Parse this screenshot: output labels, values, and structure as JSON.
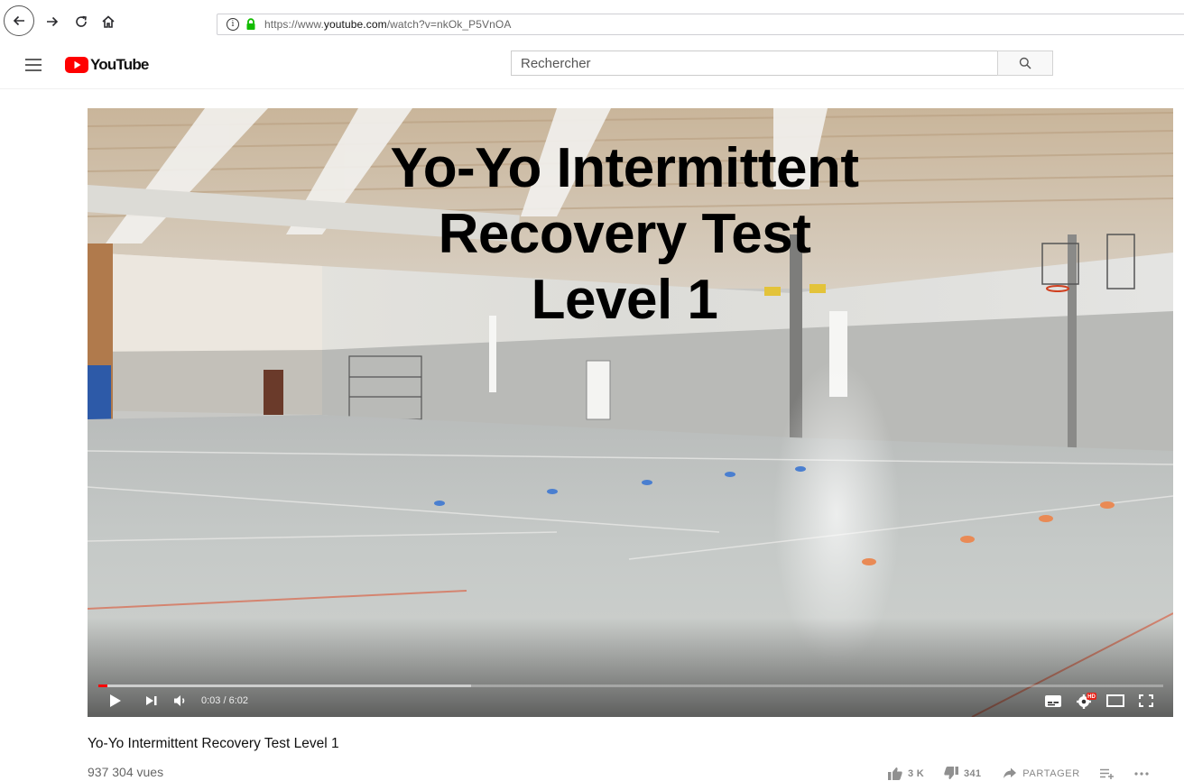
{
  "browser": {
    "url_prefix": "https://www.",
    "url_domain": "youtube.com",
    "url_path": "/watch?v=nkOk_P5VnOA"
  },
  "masthead": {
    "logo_text": "YouTube",
    "search_placeholder": "Rechercher"
  },
  "player": {
    "overlay_title_lines": [
      "Yo-Yo Intermittent",
      "Recovery Test",
      "Level 1"
    ],
    "time_current": "0:03",
    "time_total": "6:02",
    "time_display": "0:03 / 6:02",
    "progress_played_fraction": 0.0083,
    "progress_buffered_fraction": 0.35
  },
  "video": {
    "title": "Yo-Yo Intermittent Recovery Test Level 1",
    "views": "937 304 vues",
    "likes": "3 K",
    "dislikes": "341",
    "share_label": "PARTAGER"
  },
  "colors": {
    "youtube_red": "#ff0000",
    "progress_played": "#ff0000"
  },
  "icons": [
    "back-icon",
    "forward-icon",
    "reload-icon",
    "home-icon",
    "info-icon",
    "lock-icon",
    "menu-icon",
    "search-icon",
    "play-icon",
    "next-icon",
    "volume-icon",
    "subtitles-icon",
    "settings-icon",
    "theater-icon",
    "fullscreen-icon",
    "thumbs-up-icon",
    "thumbs-down-icon",
    "share-icon",
    "add-to-playlist-icon",
    "more-icon"
  ]
}
